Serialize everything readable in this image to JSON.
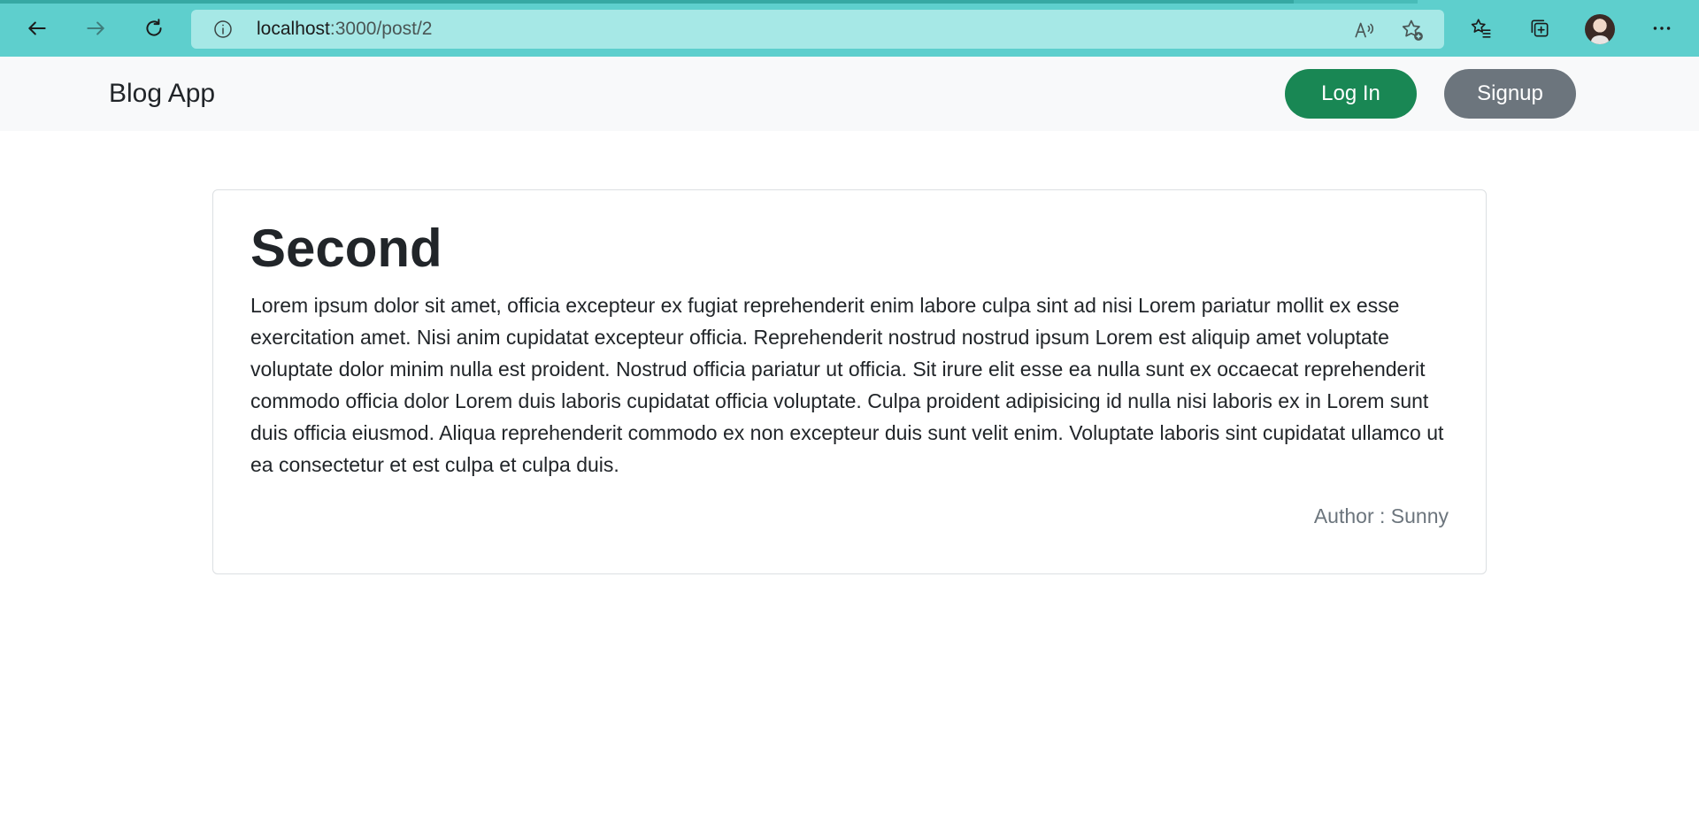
{
  "browser": {
    "url_host": "localhost",
    "url_path": ":3000/post/2",
    "colors": {
      "chrome": "#5ecfcd",
      "address_bar": "#a6e8e6"
    }
  },
  "navbar": {
    "brand": "Blog App",
    "login_label": "Log In",
    "signup_label": "Signup"
  },
  "post": {
    "title": "Second",
    "body": "Lorem ipsum dolor sit amet, officia excepteur ex fugiat reprehenderit enim labore culpa sint ad nisi Lorem pariatur mollit ex esse exercitation amet. Nisi anim cupidatat excepteur officia. Reprehenderit nostrud nostrud ipsum Lorem est aliquip amet voluptate voluptate dolor minim nulla est proident. Nostrud officia pariatur ut officia. Sit irure elit esse ea nulla sunt ex occaecat reprehenderit commodo officia dolor Lorem duis laboris cupidatat officia voluptate. Culpa proident adipisicing id nulla nisi laboris ex in Lorem sunt duis officia eiusmod. Aliqua reprehenderit commodo ex non excepteur duis sunt velit enim. Voluptate laboris sint cupidatat ullamco ut ea consectetur et est culpa et culpa duis.",
    "author": "Author : Sunny"
  },
  "colors": {
    "login_button": "#198754",
    "signup_button": "#6c757d",
    "navbar_bg": "#f8f9fa"
  }
}
